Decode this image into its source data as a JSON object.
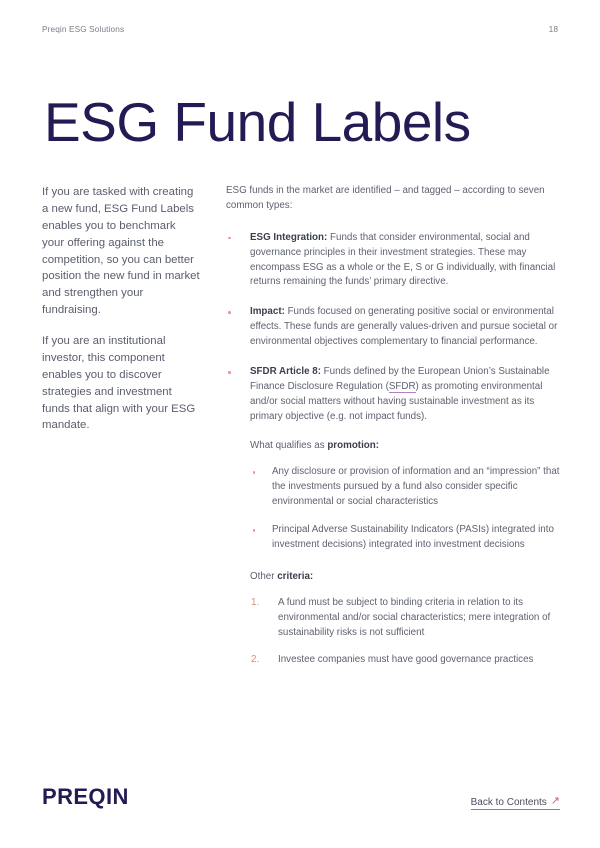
{
  "header": {
    "label": "Preqin ESG Solutions",
    "page_number": "18"
  },
  "title": "ESG Fund Labels",
  "left_column": {
    "paragraph_1": "If you are tasked with creating a new fund, ESG Fund Labels enables you to benchmark your offering against the competition, so you can better position the new fund in market and strengthen your fundraising.",
    "paragraph_2": "If you are an institutional investor, this component enables you to discover strategies and investment funds that align with your ESG mandate."
  },
  "right_column": {
    "intro": "ESG funds in the market are identified – and tagged – according to seven common types:",
    "bullets": [
      {
        "lead": "ESG Integration:",
        "text": " Funds that consider environmental, social and governance principles in their investment strategies. These may encompass ESG as a whole or the E, S or G individually, with financial returns remaining the funds’ primary directive."
      },
      {
        "lead": "Impact:",
        "text": " Funds focused on generating positive social or environmental effects. These funds are generally values-driven and pursue societal or environmental objectives complementary to financial performance."
      }
    ],
    "sfdr_bullet": {
      "lead": "SFDR Article 8:",
      "text_before_link": " Funds defined by the European Union’s Sustainable Finance Disclosure Regulation (",
      "link_text": "SFDR",
      "text_after_link": ") as promoting environmental and/or social matters without having sustainable investment as its primary objective (e.g. not impact funds)."
    },
    "promotion": {
      "heading_prefix": "What qualifies as ",
      "heading_bold": "promotion:",
      "items": [
        "Any disclosure or provision of information and an “impression” that the investments pursued by a fund also consider specific environmental or social characteristics",
        "Principal Adverse Sustainability Indicators (PASIs) integrated into investment decisions) integrated into investment decisions"
      ]
    },
    "other_criteria": {
      "heading_prefix": "Other ",
      "heading_bold": "criteria:",
      "items": [
        {
          "number": "1.",
          "text": "A fund must be subject to binding criteria in relation to its environmental and/or social characteristics; mere integration of sustainability risks is not sufficient"
        },
        {
          "number": "2.",
          "text": "Investee companies must have good governance practices"
        }
      ]
    }
  },
  "footer": {
    "logo": "PREQIN",
    "back_link": "Back to Contents",
    "back_arrow_glyph": "↗"
  },
  "colors": {
    "title_navy": "#231b53",
    "body_gray": "#5e6270",
    "bullet_pink": "#e8959c",
    "number_orange": "#e2867d",
    "link_underline_purple": "#b37fc4",
    "back_link_pink": "#d9558f",
    "page_background": "#ffffff"
  }
}
